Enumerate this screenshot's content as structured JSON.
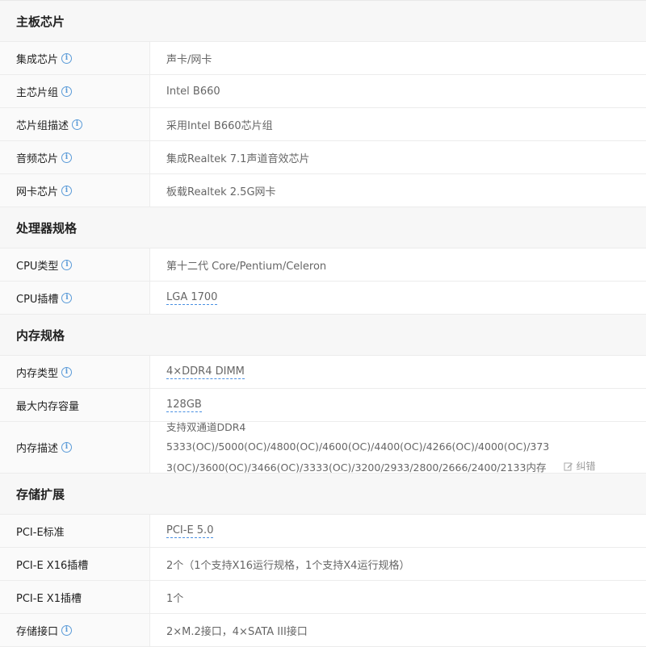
{
  "sections": [
    {
      "title": "主板芯片",
      "rows": [
        {
          "label": "集成芯片",
          "value": "声卡/网卡"
        },
        {
          "label": "主芯片组",
          "value": "Intel B660"
        },
        {
          "label": "芯片组描述",
          "value": "采用Intel B660芯片组"
        },
        {
          "label": "音频芯片",
          "value": "集成Realtek 7.1声道音效芯片"
        },
        {
          "label": "网卡芯片",
          "value": "板载Realtek 2.5G网卡"
        }
      ]
    },
    {
      "title": "处理器规格",
      "rows": [
        {
          "label": "CPU类型",
          "value": "第十二代 Core/Pentium/Celeron"
        },
        {
          "label": "CPU插槽",
          "value": "LGA 1700"
        }
      ]
    },
    {
      "title": "内存规格",
      "rows": [
        {
          "label": "内存类型",
          "value": "4×DDR4 DIMM"
        },
        {
          "label": "最大内存容量",
          "value": "128GB"
        },
        {
          "label": "内存描述",
          "value_line1": "支持双通道DDR4 5333(OC)/5000(OC)/4800(OC)/4600(OC)/4400(OC)/4266(OC)/4000(OC)/373",
          "value_line2": "3(OC)/3600(OC)/3466(OC)/3333(OC)/3200/2933/2800/2666/2400/2133内存",
          "correct_label": "纠错"
        }
      ]
    },
    {
      "title": "存储扩展",
      "rows": [
        {
          "label": "PCI-E标准",
          "value": "PCI-E 5.0"
        },
        {
          "label": "PCI-E X16插槽",
          "value": "2个（1个支持X16运行规格，1个支持X4运行规格）"
        },
        {
          "label": "PCI-E X1插槽",
          "value": "1个"
        },
        {
          "label": "存储接口",
          "value": "2×M.2接口，4×SATA III接口"
        }
      ]
    }
  ],
  "icons": {
    "info": "info-icon",
    "edit": "edit-icon"
  },
  "colors": {
    "accent": "#4a90e2",
    "header_bg": "#f7f7f7",
    "label_bg": "#fafafa"
  }
}
